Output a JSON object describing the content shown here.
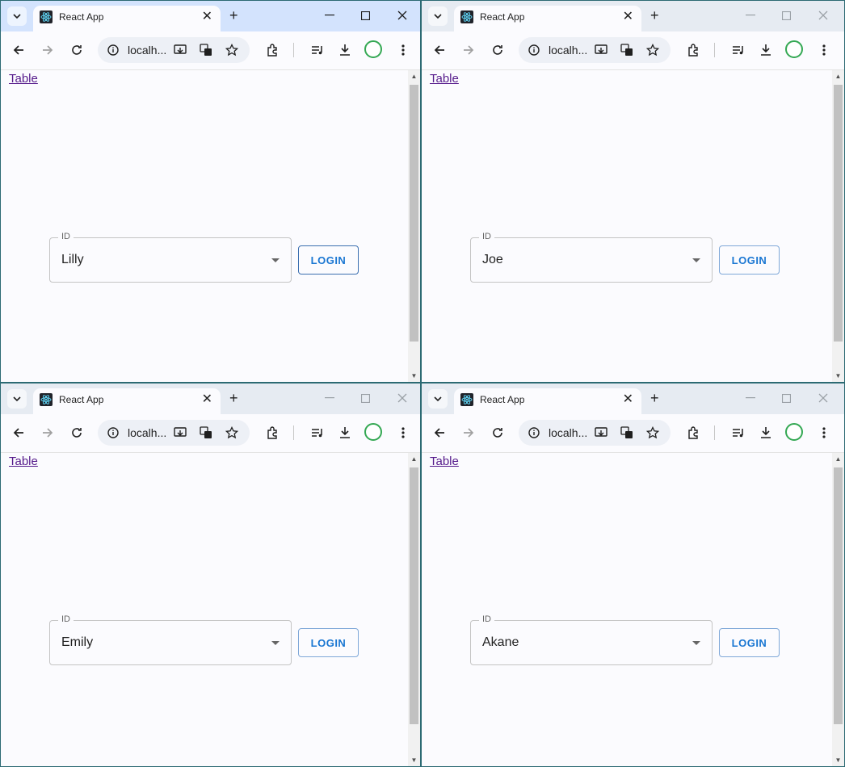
{
  "colors": {
    "tab_active_bar": "#d3e3fd",
    "tab_inactive_bar": "#e6ebf2",
    "page_bg": "#fbfbfe",
    "accent": "#1976d2",
    "link": "#551a8b"
  },
  "windows": [
    {
      "tab_title": "React App",
      "url": "localh...",
      "nav_link": "Table",
      "field_label": "ID",
      "field_value": "Lilly",
      "button_label": "LOGIN",
      "active": true
    },
    {
      "tab_title": "React App",
      "url": "localh...",
      "nav_link": "Table",
      "field_label": "ID",
      "field_value": "Joe",
      "button_label": "LOGIN",
      "active": false
    },
    {
      "tab_title": "React App",
      "url": "localh...",
      "nav_link": "Table",
      "field_label": "ID",
      "field_value": "Emily",
      "button_label": "LOGIN",
      "active": false
    },
    {
      "tab_title": "React App",
      "url": "localh...",
      "nav_link": "Table",
      "field_label": "ID",
      "field_value": "Akane",
      "button_label": "LOGIN",
      "active": false
    }
  ]
}
